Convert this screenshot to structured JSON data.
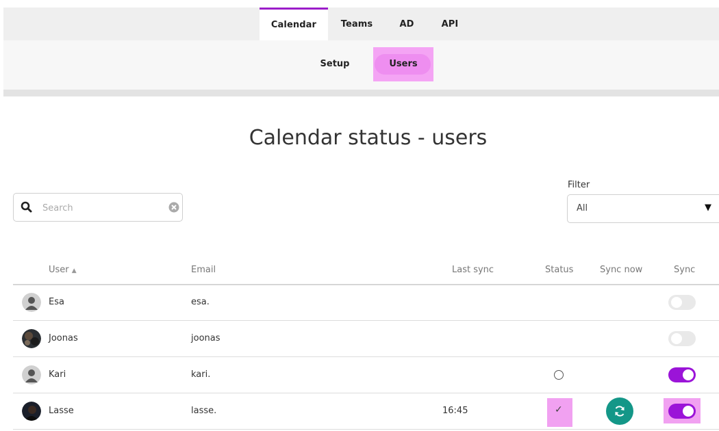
{
  "nav": {
    "tabs": [
      {
        "label": "Calendar",
        "active": true
      },
      {
        "label": "Teams",
        "active": false
      },
      {
        "label": "AD",
        "active": false
      },
      {
        "label": "API",
        "active": false
      }
    ],
    "subtabs": [
      {
        "label": "Setup",
        "active": false
      },
      {
        "label": "Users",
        "active": true
      }
    ]
  },
  "page": {
    "title": "Calendar status - users"
  },
  "search": {
    "placeholder": "Search",
    "value": ""
  },
  "filter": {
    "label": "Filter",
    "selected": "All"
  },
  "table": {
    "columns": [
      "User",
      "Email",
      "Last sync",
      "Status",
      "Sync now",
      "Sync"
    ],
    "sort_indicator": "▲",
    "rows": [
      {
        "user": "Esa",
        "email": "esa.",
        "last_sync": "",
        "status": "",
        "sync_now": false,
        "sync": false,
        "avatar": "default-avatar"
      },
      {
        "user": "Joonas",
        "email": "joonas",
        "last_sync": "",
        "status": "",
        "sync_now": false,
        "sync": false,
        "avatar": "photo-avatar"
      },
      {
        "user": "Kari",
        "email": "kari.",
        "last_sync": "",
        "status": "pending",
        "sync_now": false,
        "sync": true,
        "avatar": "default-avatar"
      },
      {
        "user": "Lasse",
        "email": "lasse.",
        "last_sync": "16:45",
        "status": "ok",
        "sync_now": true,
        "sync": true,
        "avatar": "photo-avatar"
      }
    ]
  },
  "colors": {
    "accent": "#9b14d8",
    "highlight": "#f1a1f1",
    "sync_button": "#149788"
  },
  "icons": {
    "search": "search-icon",
    "clear": "clear-search-icon",
    "dropdown": "dropdown-arrow-icon",
    "sort": "sort-ascending-icon",
    "status_pending": "status-pending-icon",
    "status_ok": "checkmark-icon",
    "sync_now": "refresh-icon"
  }
}
